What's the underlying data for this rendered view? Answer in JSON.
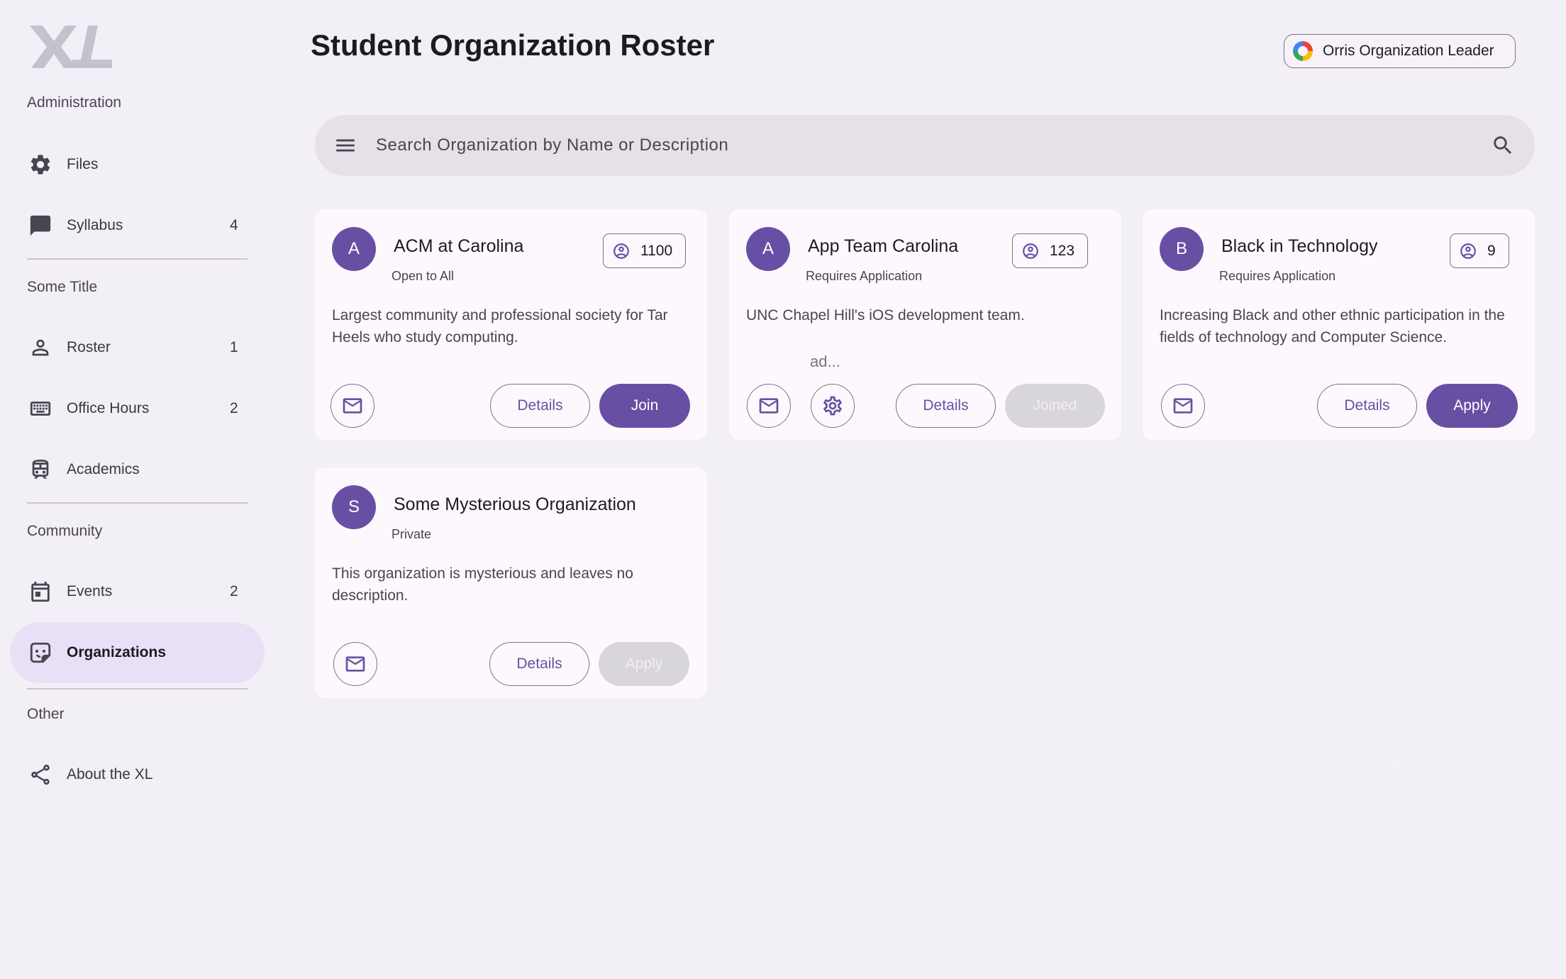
{
  "app": {
    "logo_text": "XL"
  },
  "sidebar": {
    "sections": [
      {
        "title": "Administration"
      },
      {
        "title": "Some Title"
      },
      {
        "title": "Community"
      },
      {
        "title": "Other"
      }
    ],
    "items": [
      {
        "label": "Files",
        "icon": "gear-icon",
        "badge": ""
      },
      {
        "label": "Syllabus",
        "icon": "chat-icon",
        "badge": "4"
      },
      {
        "label": "Roster",
        "icon": "person-icon",
        "badge": "1"
      },
      {
        "label": "Office Hours",
        "icon": "keyboard-icon",
        "badge": "2"
      },
      {
        "label": "Academics",
        "icon": "bus-icon",
        "badge": ""
      },
      {
        "label": "Events",
        "icon": "calendar-icon",
        "badge": "2"
      },
      {
        "label": "Organizations",
        "icon": "sticker-icon",
        "badge": "",
        "active": true
      },
      {
        "label": "About the XL",
        "icon": "share-icon",
        "badge": ""
      }
    ]
  },
  "header": {
    "title": "Student Organization Roster",
    "user_chip": "Orris Organization Leader"
  },
  "search": {
    "placeholder": "Search Organization by Name or Description"
  },
  "organizations": [
    {
      "initial": "A",
      "name": "ACM at Carolina",
      "access": "Open to All",
      "members": "1100",
      "description": "Largest community and professional society for Tar Heels who study computing.",
      "details_label": "Details",
      "action_label": "Join",
      "action_state": "enabled"
    },
    {
      "initial": "A",
      "name": "App Team Carolina",
      "access": "Requires Application",
      "members": "123",
      "description": "UNC Chapel Hill's iOS development team.",
      "extra_text": "ad...",
      "details_label": "Details",
      "action_label": "Joined",
      "action_state": "disabled"
    },
    {
      "initial": "B",
      "name": "Black in Technology",
      "access": "Requires Application",
      "members": "9",
      "description": "Increasing Black and other ethnic participation in the fields of technology and Computer Science.",
      "details_label": "Details",
      "action_label": "Apply",
      "action_state": "enabled"
    },
    {
      "initial": "S",
      "name": "Some Mysterious Organization",
      "access": "Private",
      "members": "",
      "description": "This organization is mysterious and leaves no description.",
      "details_label": "Details",
      "action_label": "Apply",
      "action_state": "disabled"
    }
  ],
  "ghost_text": "17",
  "colors": {
    "accent": "#6750a4",
    "background": "#f3eff7",
    "card": "#fdf8fd",
    "active_nav": "#e8e0f6",
    "disabled_button": "#d9d5dc"
  }
}
